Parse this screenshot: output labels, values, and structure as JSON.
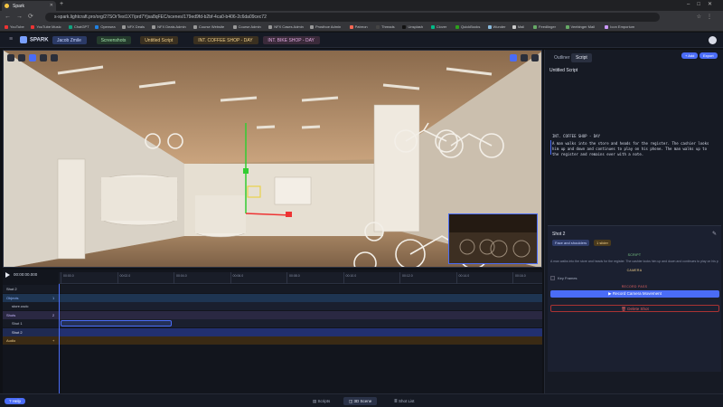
{
  "browser": {
    "tab_title": "Spark",
    "url": "s-spark.lightcraft.pro/org/27SOrTest1X7/prd7Yjsa8qFEC/scenes/179ed9fd-b2bf-4ca0-b406-2c6da09cec72",
    "bookmarks": [
      "YouTube",
      "YouTube Music",
      "ChatGPT",
      "Opensea",
      "NFX Deals",
      "NFX Deals Admin",
      "Course Website",
      "Course Admin",
      "NFX Cases Admin",
      "Prosthoe Admin",
      "Patreon",
      "Threads",
      "Unsplash",
      "Clover",
      "QuickBooks",
      "Wunder",
      "Mail",
      "Feedlinger",
      "Veebinger Mail",
      "Icon Emporium"
    ]
  },
  "header": {
    "logo_text": "SPARK",
    "breadcrumbs": [
      {
        "label": "Jacob Zmile",
        "color": "#2b3a66",
        "text": "#c8d4ff"
      },
      {
        "label": "Screenshots",
        "color": "#243a2c",
        "text": "#9fe0a8"
      },
      {
        "label": "Untitled Script",
        "color": "#3a3020",
        "text": "#f0cf8a"
      },
      {
        "label": "INT. COFFEE SHOP - DAY",
        "color": "#3a3020",
        "text": "#f0cf8a"
      },
      {
        "label": "INT. BIKE SHOP - DAY",
        "color": "#3a2a3a",
        "text": "#e0a8e0"
      }
    ]
  },
  "right_panel": {
    "tabs": [
      "Outliner",
      "Script"
    ],
    "active_tab": "Script",
    "add_label": "+ Add",
    "export_label": "Export",
    "script_title": "Untitled Script",
    "scene_heading": "INT. COFFEE SHOP - DAY",
    "action_lines": [
      "A man walks into the store and heads for the register. The cashier looks",
      "him up and down and continues to play on his phone. The man walks up to",
      "the register and remains ever with a note."
    ],
    "shot": {
      "title": "Shot 2",
      "tags": [
        "Face and shoulders",
        "1 slider"
      ],
      "script_heading": "SCRIPT",
      "script_excerpt": "A man walks into the store and heads for the register. The cashier looks him up and down and continues to play on his phone.",
      "camera_heading": "CAMERA",
      "keyframes_label": "Key Frames",
      "record_heading": "RECORD PASS",
      "record_button": "Record Camera Movement",
      "delete_button": "Delete Shot"
    }
  },
  "timeline": {
    "timecode": "00:00:00.000",
    "ticks": [
      "00:00.0",
      "00:02.0",
      "00:04.0",
      "00:06.0",
      "00:08.0",
      "00:10.0",
      "00:12.0",
      "00:14.0",
      "00:16.0"
    ],
    "rows": [
      {
        "label": "Shot 2",
        "kind": "shot-header",
        "badge": ""
      },
      {
        "label": "Objects",
        "kind": "group",
        "badge": "1"
      },
      {
        "label": "store.usdc",
        "kind": "item",
        "badge": ""
      },
      {
        "label": "Shots",
        "kind": "group-alt",
        "badge": "2"
      },
      {
        "label": "Shot 1",
        "kind": "item",
        "badge": ""
      },
      {
        "label": "Shot 2",
        "kind": "item-active",
        "badge": ""
      },
      {
        "label": "Audio",
        "kind": "group-audio",
        "badge": "+"
      }
    ]
  },
  "bottom_bar": {
    "help_label": "Help",
    "tabs": [
      "Scripts",
      "3D Scene",
      "Shot List"
    ],
    "active_tab": "3D Scene"
  }
}
